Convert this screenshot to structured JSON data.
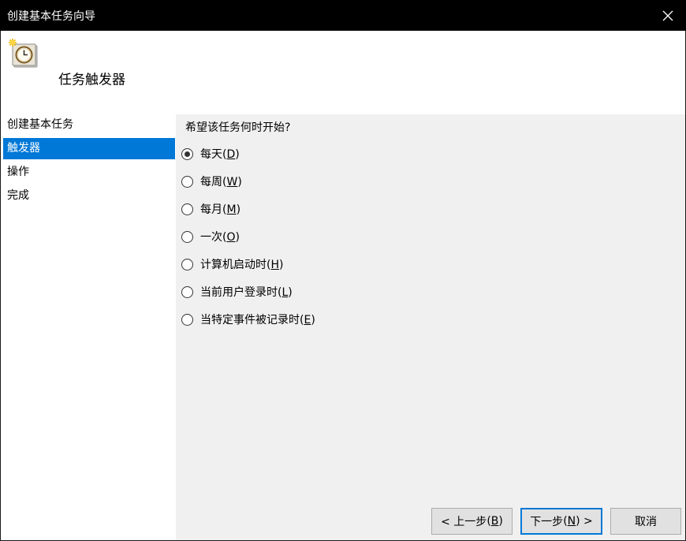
{
  "window": {
    "title": "创建基本任务向导"
  },
  "header": {
    "heading": "任务触发器"
  },
  "sidebar": {
    "items": [
      {
        "label": "创建基本任务"
      },
      {
        "label": "触发器"
      },
      {
        "label": "操作"
      },
      {
        "label": "完成"
      }
    ],
    "active_index": 1
  },
  "content": {
    "question": "希望该任务何时开始?",
    "options": [
      {
        "text": "每天",
        "key": "D",
        "checked": true
      },
      {
        "text": "每周",
        "key": "W",
        "checked": false
      },
      {
        "text": "每月",
        "key": "M",
        "checked": false
      },
      {
        "text": "一次",
        "key": "O",
        "checked": false
      },
      {
        "text": "计算机启动时",
        "key": "H",
        "checked": false
      },
      {
        "text": "当前用户登录时",
        "key": "L",
        "checked": false
      },
      {
        "text": "当特定事件被记录时",
        "key": "E",
        "checked": false
      }
    ]
  },
  "buttons": {
    "back": {
      "text": "< 上一步",
      "key": "B"
    },
    "next": {
      "text": "下一步",
      "key": "N",
      "suffix": " >"
    },
    "cancel": {
      "text": "取消"
    }
  },
  "colors": {
    "titlebar": "#000000",
    "selection": "#0078d7",
    "panel": "#f0f0f0"
  }
}
